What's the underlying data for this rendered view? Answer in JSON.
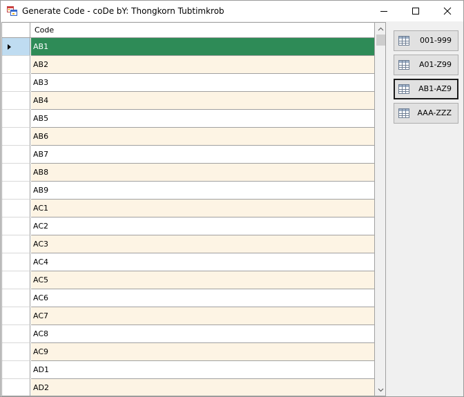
{
  "window": {
    "title": "Generate Code - coDe bY: Thongkorn Tubtimkrob"
  },
  "grid": {
    "column_header": "Code",
    "rows": [
      {
        "code": "AB1"
      },
      {
        "code": "AB2"
      },
      {
        "code": "AB3"
      },
      {
        "code": "AB4"
      },
      {
        "code": "AB5"
      },
      {
        "code": "AB6"
      },
      {
        "code": "AB7"
      },
      {
        "code": "AB8"
      },
      {
        "code": "AB9"
      },
      {
        "code": "AC1"
      },
      {
        "code": "AC2"
      },
      {
        "code": "AC3"
      },
      {
        "code": "AC4"
      },
      {
        "code": "AC5"
      },
      {
        "code": "AC6"
      },
      {
        "code": "AC7"
      },
      {
        "code": "AC8"
      },
      {
        "code": "AC9"
      },
      {
        "code": "AD1"
      },
      {
        "code": "AD2"
      }
    ],
    "selected_row_index": 0
  },
  "buttons": [
    {
      "label": "001-999",
      "icon": "table-icon"
    },
    {
      "label": "A01-Z99",
      "icon": "table-icon"
    },
    {
      "label": "AB1-AZ9",
      "icon": "table-icon",
      "focused": true
    },
    {
      "label": "AAA-ZZZ",
      "icon": "table-icon"
    }
  ],
  "colors": {
    "selected_row": "#2e8b57",
    "alternate_row": "#fdf4e4",
    "row_header_selected": "#bfdcf1"
  }
}
